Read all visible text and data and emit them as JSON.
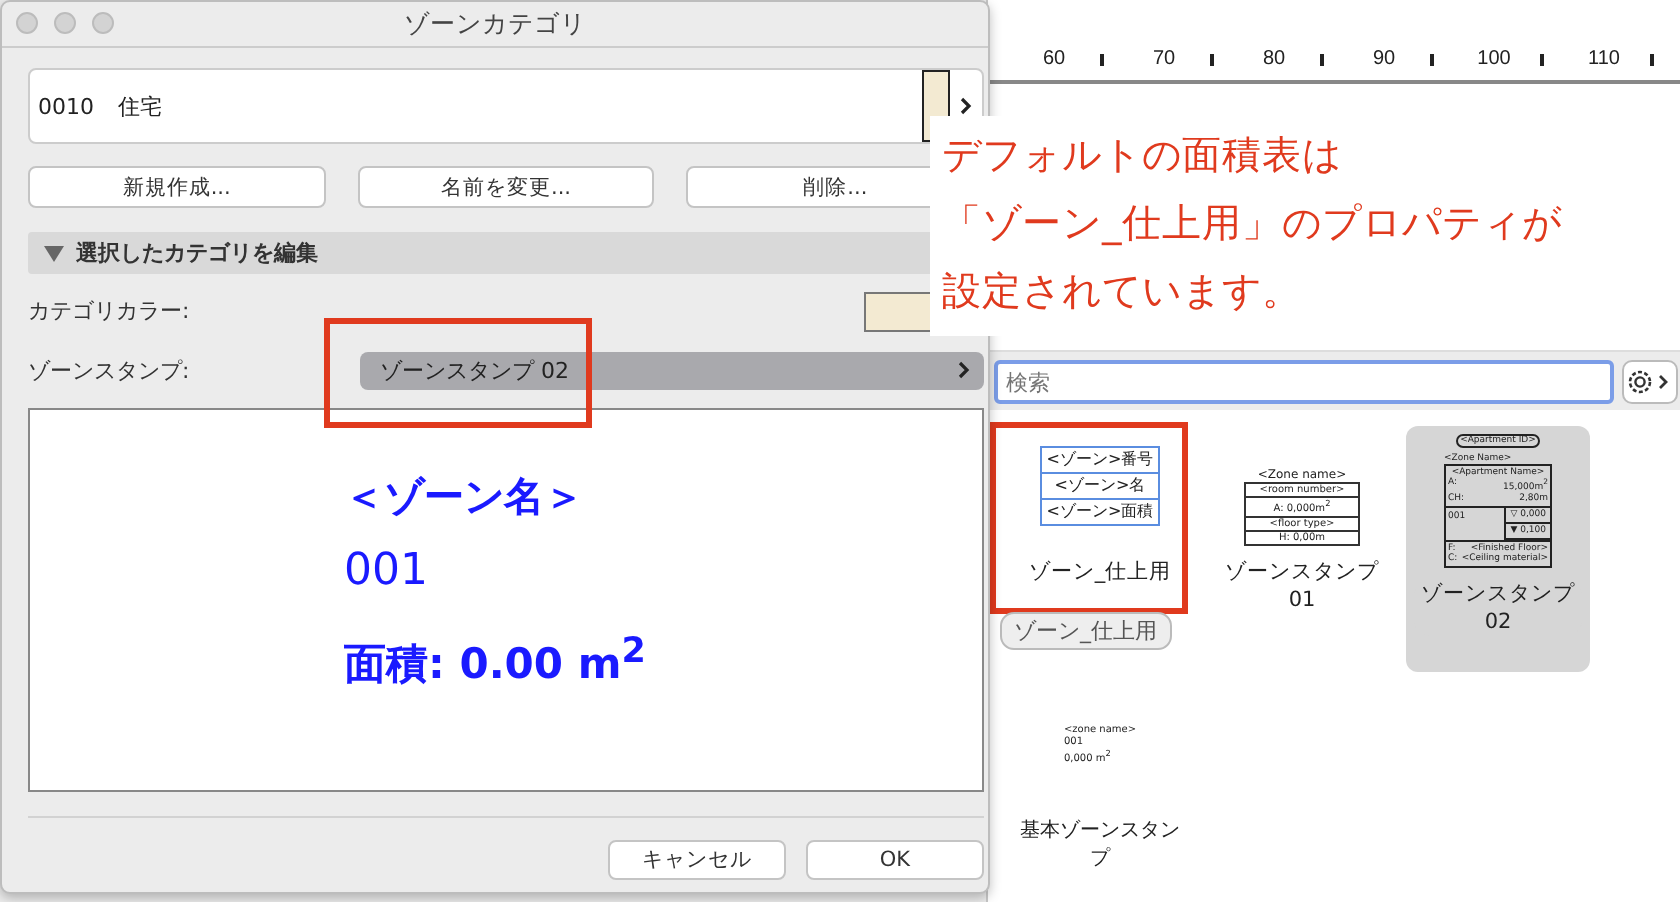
{
  "dialog": {
    "title": "ゾーンカテゴリ",
    "category": {
      "code": "0010",
      "name": "住宅",
      "color": "#f3ead2"
    },
    "buttons": [
      "新規作成...",
      "名前を変更...",
      "削除..."
    ],
    "section": {
      "label": "選択したカテゴリを編集",
      "expanded": true
    },
    "color_label": "カテゴリカラー:",
    "stamp_label": "ゾーンスタンプ:",
    "stamp_field": {
      "value": "ゾーンスタンプ 02",
      "highlighted": true
    },
    "preview": {
      "name": "＜ゾーン名＞",
      "number": "001",
      "area": "面積: 0.00 m$^{2}$"
    },
    "footer_buttons": [
      "キャンセル",
      "OK"
    ]
  },
  "ruler": {
    "labels": [
      "60",
      "70",
      "80",
      "90",
      "100",
      "110"
    ]
  },
  "annotation": [
    "デフォルトの面積表は",
    "「ゾーン_仕上用」のプロパティが",
    "設定されています。"
  ],
  "search": {
    "placeholder": "検索"
  },
  "stamps": [
    {
      "kind": "finish",
      "label": "ゾーン_仕上用",
      "selected": false,
      "highlighted": true,
      "lines": [
        "<ゾーン>番号",
        "<ゾーン>名",
        "<ゾーン>面積"
      ]
    },
    {
      "kind": "table",
      "label": "ゾーンスタンプ 01",
      "selected": false,
      "highlighted": false,
      "lines": [
        "<Zone name>",
        "<room number>",
        "A: 0,000m$^{2}$",
        "<floor type>",
        "H: 0,00m"
      ]
    },
    {
      "kind": "apartment",
      "label": "ゾーンスタンプ 02",
      "selected": true,
      "highlighted": false,
      "lines": [
        "<Apartment ID>",
        "<Zone Name>",
        "<Apartment Name>",
        "A:",
        "15,000m$^{2}$",
        "CH:",
        "2,80m",
        "001",
        "▽ 0,000",
        "▼ 0,100",
        "F:",
        "<Finished Floor>",
        "C:",
        "<Ceiling material>"
      ]
    },
    {
      "kind": "basic",
      "label": "基本ゾーンスタンプ",
      "selected": false,
      "highlighted": false,
      "lines": [
        "<zone name>",
        "001",
        "0,000 m$^{2}$"
      ]
    }
  ],
  "tooltip": "ゾーン_仕上用"
}
